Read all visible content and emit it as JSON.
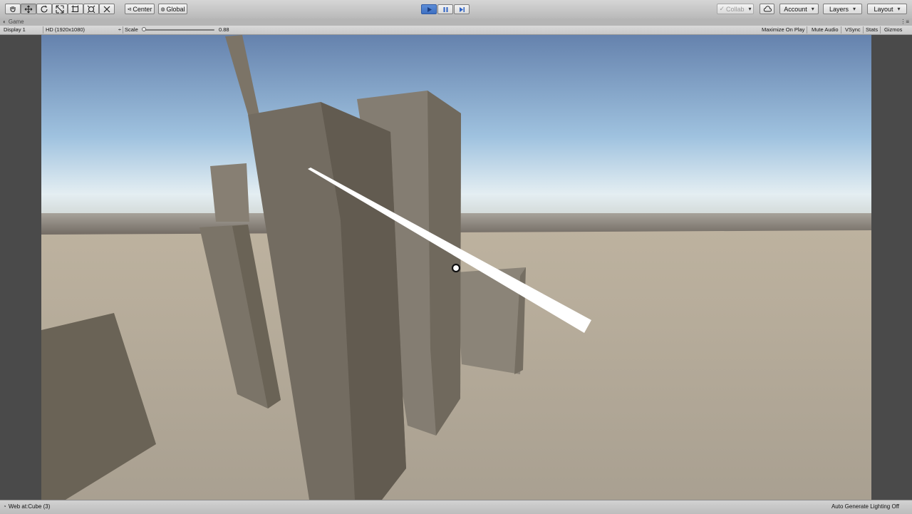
{
  "toolbar": {
    "tools": [
      {
        "icon": "hand-icon"
      },
      {
        "icon": "move-icon"
      },
      {
        "icon": "rotate-icon"
      },
      {
        "icon": "scale-icon"
      },
      {
        "icon": "rect-icon"
      },
      {
        "icon": "transform-icon"
      },
      {
        "icon": "custom-tool-icon"
      }
    ],
    "pivot_label": "Center",
    "space_label": "Global",
    "collab_label": "Collab",
    "account_label": "Account",
    "layers_label": "Layers",
    "layout_label": "Layout",
    "play_state": "playing"
  },
  "game_tab": {
    "label": "Game"
  },
  "game_toolbar": {
    "display": "Display 1",
    "resolution": "HD (1920x1080)",
    "scale_label": "Scale",
    "scale_value": "0.88",
    "scale_fraction": 0.0,
    "maximize_on_play": "Maximize On Play",
    "mute_audio": "Mute Audio",
    "vsync": "VSync",
    "stats": "Stats",
    "gizmos": "Gizmos"
  },
  "status": {
    "message": "Web at:Cube (3)",
    "lighting": "Auto Generate Lighting Off"
  },
  "colors": {
    "play_active": "#3d6fc2",
    "sky_top": "#6582ad",
    "sky_horizon": "#e4eef2",
    "ground": "#b3aa98",
    "cube_light": "#8d857a",
    "cube_dark": "#676052",
    "web_line": "#ffffff"
  }
}
